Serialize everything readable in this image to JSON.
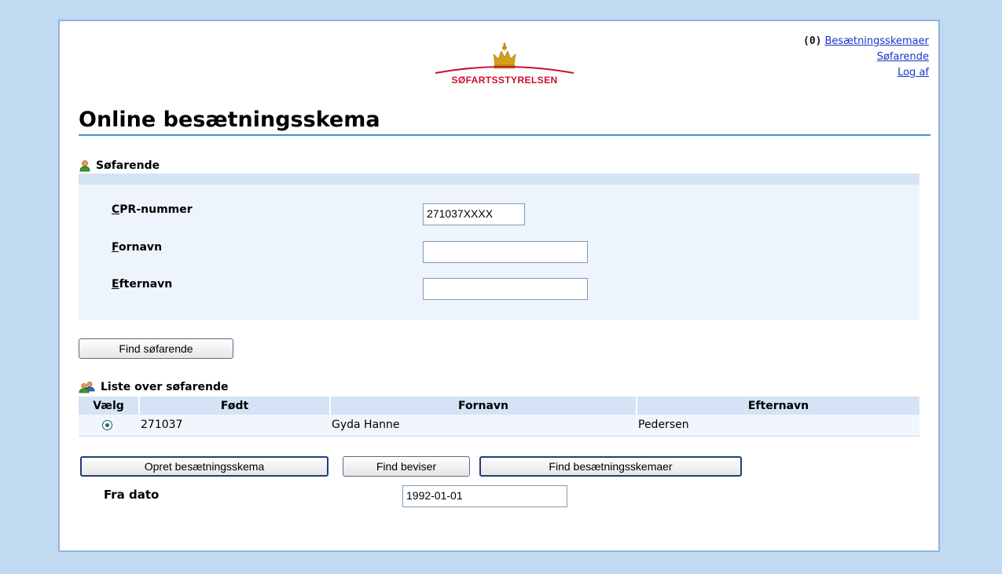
{
  "header": {
    "cart_count": "(0)",
    "links": [
      "Besætningsskemaer",
      "Søfarende",
      "Log af"
    ],
    "logo_text": "SØFARTSSTYRELSEN"
  },
  "page_title": "Online besætningsskema",
  "search_section": {
    "heading": "Søfarende",
    "fields": [
      {
        "label_key": "C",
        "label_rest": "PR-nummer",
        "value": "271037XXXX"
      },
      {
        "label_key": "F",
        "label_rest": "ornavn",
        "value": ""
      },
      {
        "label_key": "E",
        "label_rest": "fternavn",
        "value": ""
      }
    ],
    "find_button": "Find søfarende"
  },
  "results_section": {
    "heading": "Liste over søfarende",
    "columns": [
      "Vælg",
      "Født",
      "Fornavn",
      "Efternavn"
    ],
    "rows": [
      {
        "selected": true,
        "born": "271037",
        "first_name": "Gyda Hanne",
        "last_name": "Pedersen"
      }
    ]
  },
  "actions": {
    "create_button": "Opret besætningsskema",
    "find_certificates_button": "Find beviser",
    "find_schemas_button": "Find besætningsskemaer"
  },
  "date_filter": {
    "label": "Fra dato",
    "value": "1992-01-01"
  },
  "colors": {
    "background": "#c2d9f2",
    "brand_red": "#c8102e",
    "accent_blue": "#4a90c8",
    "panel": "#eef4fb"
  }
}
